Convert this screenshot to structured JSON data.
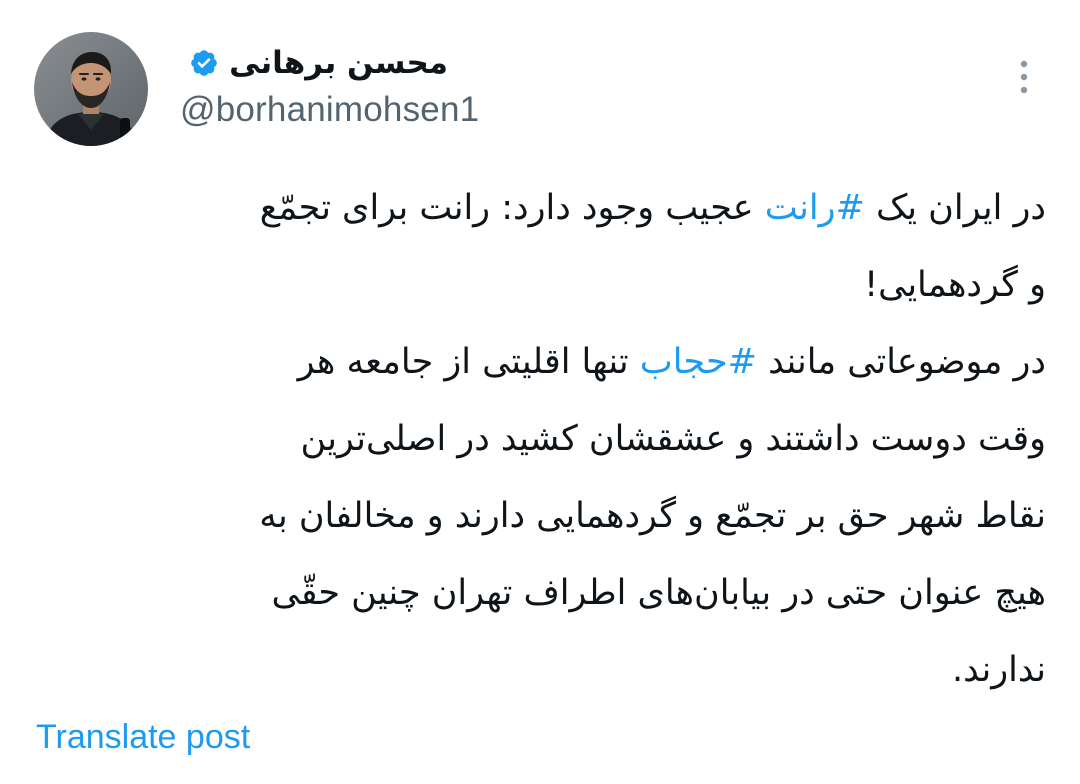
{
  "author": {
    "display_name": "محسن برهانی",
    "handle": "@borhanimohsen1",
    "verified": true,
    "avatar_icon": "profile-photo",
    "badge_color": "#1d9bf0"
  },
  "menu": {
    "icon": "more-vertical-icon"
  },
  "tweet": {
    "lines": [
      {
        "before": "در ایران یک ",
        "hashtag": "#رانت",
        "after": " عجیب وجود دارد: رانت برای تجمّع"
      },
      {
        "before": "و گردهمایی!",
        "hashtag": "",
        "after": ""
      },
      {
        "before": "در موضوعاتی مانند ",
        "hashtag": "#حجاب",
        "after": " تنها اقلیتی از جامعه هر"
      },
      {
        "before": "وقت دوست داشتند و عشقشان کشید در اصلی‌ترین",
        "hashtag": "",
        "after": ""
      },
      {
        "before": "نقاط شهر حق بر تجمّع و گردهمایی دارند و مخالفان به",
        "hashtag": "",
        "after": ""
      },
      {
        "before": "هیچ عنوان حتی در بیابان‌های اطراف تهران چنین حقّی",
        "hashtag": "",
        "after": ""
      },
      {
        "before": "ندارند.",
        "hashtag": "",
        "after": ""
      }
    ]
  },
  "actions": {
    "translate_label": "Translate post"
  },
  "colors": {
    "text": "#0f1419",
    "secondary": "#536471",
    "link": "#1d9bf0",
    "background": "#ffffff"
  }
}
